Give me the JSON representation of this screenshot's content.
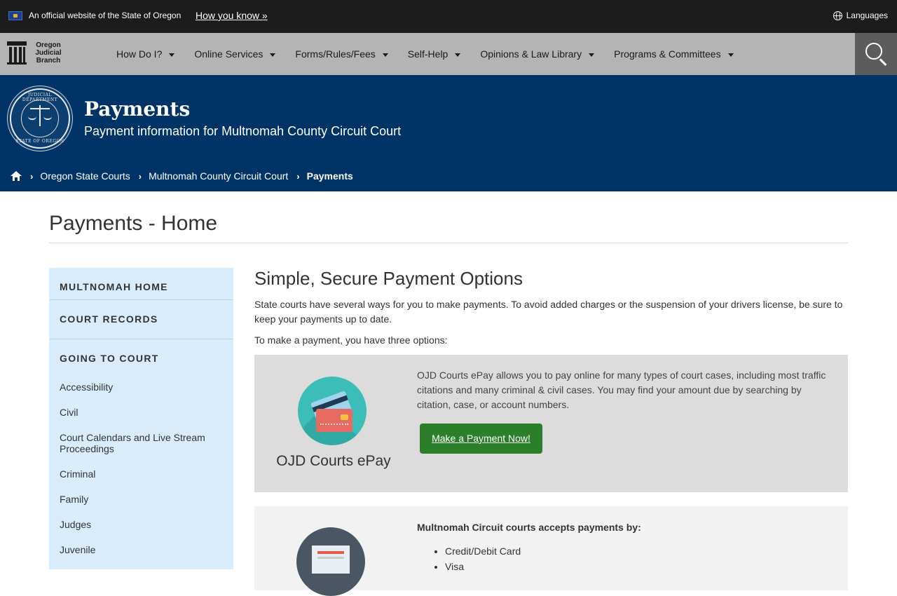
{
  "official_bar": {
    "text": "An official website of the State of Oregon",
    "how_link": "How you know »",
    "languages": "Languages"
  },
  "logo": {
    "text": "Oregon Judicial Branch"
  },
  "nav": {
    "items": [
      {
        "label": "How Do I?"
      },
      {
        "label": "Online Services"
      },
      {
        "label": "Forms/Rules/Fees"
      },
      {
        "label": "Self-Help"
      },
      {
        "label": "Opinions & Law Library"
      },
      {
        "label": "Programs & Committees"
      }
    ]
  },
  "hero": {
    "seal_top": "JUDICIAL DEPARTMENT",
    "seal_bottom": "STATE OF OREGON",
    "title": "Payments",
    "subtitle": "Payment information for Multnomah County Circuit Court"
  },
  "breadcrumb": {
    "items": [
      "Oregon State Courts",
      "Multnomah County Circuit Court",
      "Payments"
    ]
  },
  "page": {
    "title": "Payments - Home"
  },
  "sidebar": {
    "multnomah_home": "MULTNOMAH HOME",
    "court_records": "COURT RECORDS",
    "going_to_court": "GOING TO COURT",
    "links": [
      "Accessibility",
      "Civil",
      "Court Calendars and Live Stream Proceedings",
      "Criminal",
      "Family",
      "Judges",
      "Juvenile"
    ]
  },
  "main": {
    "section_title": "Simple, Secure Payment Options",
    "intro": "State courts have several ways for you to make payments. To avoid added charges or the suspension of your drivers license, be sure to keep your payments up to date.",
    "options": "To make a payment, you have three options:",
    "epay": {
      "label": "OJD Courts ePay",
      "description": "OJD Courts ePay allows you to pay online for many types of court cases, including most traffic citations and many criminal & civil cases. You may find your amount due by searching by citation, case, or account numbers.",
      "button": "Make a Payment Now!"
    },
    "accepts": {
      "heading": "Multnomah Circuit courts accepts payments by:",
      "items": [
        "Credit/Debit Card",
        "Visa"
      ]
    }
  },
  "colors": {
    "official_bar": "#1c1c1c",
    "nav_bar": "#b4b4b4",
    "search_button": "#5c5c5c",
    "hero": "#003466",
    "sidebar": "#d9ecfb",
    "pay_button": "#2b7f2b",
    "card1": "#dcdcdc",
    "card2": "#f2f2f2"
  },
  "icons": {
    "flag": "oregon-flag-icon",
    "languages": "globe-icon",
    "search": "search-icon",
    "home": "home-icon",
    "epay": "credit-card-icon",
    "mail": "envelope-icon"
  }
}
